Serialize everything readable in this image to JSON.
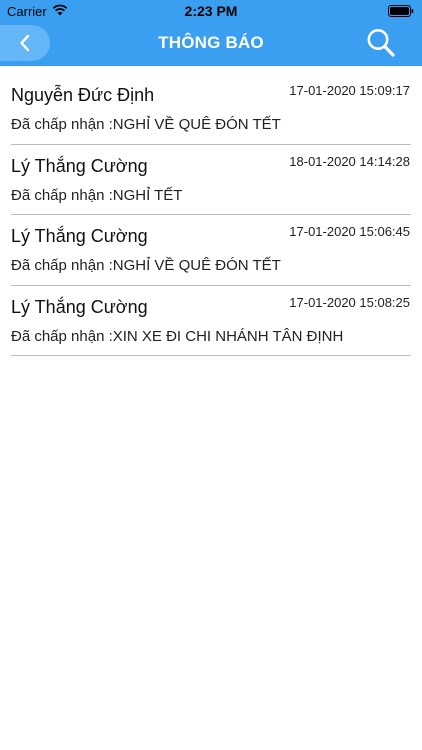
{
  "status_bar": {
    "carrier": "Carrier",
    "time": "2:23 PM"
  },
  "nav": {
    "title": "THÔNG BÁO",
    "accent_color": "#3a9ff0",
    "back_icon": "chevron-left-icon",
    "search_icon": "search-icon"
  },
  "notifications": [
    {
      "name": "Nguyễn Đức Định",
      "time": "17-01-2020 15:09:17",
      "message": "Đã chấp nhận :NGHỈ VỀ QUÊ ĐÓN TẾT"
    },
    {
      "name": "Lý Thắng Cường",
      "time": "18-01-2020 14:14:28",
      "message": "Đã chấp nhận :NGHỈ TẾT"
    },
    {
      "name": "Lý Thắng Cường",
      "time": "17-01-2020 15:06:45",
      "message": "Đã chấp nhận :NGHỈ VỀ QUÊ ĐÓN TẾT"
    },
    {
      "name": "Lý Thắng Cường",
      "time": "17-01-2020 15:08:25",
      "message": "Đã chấp nhận :XIN XE ĐI CHI NHÁNH TÂN ĐỊNH"
    }
  ]
}
